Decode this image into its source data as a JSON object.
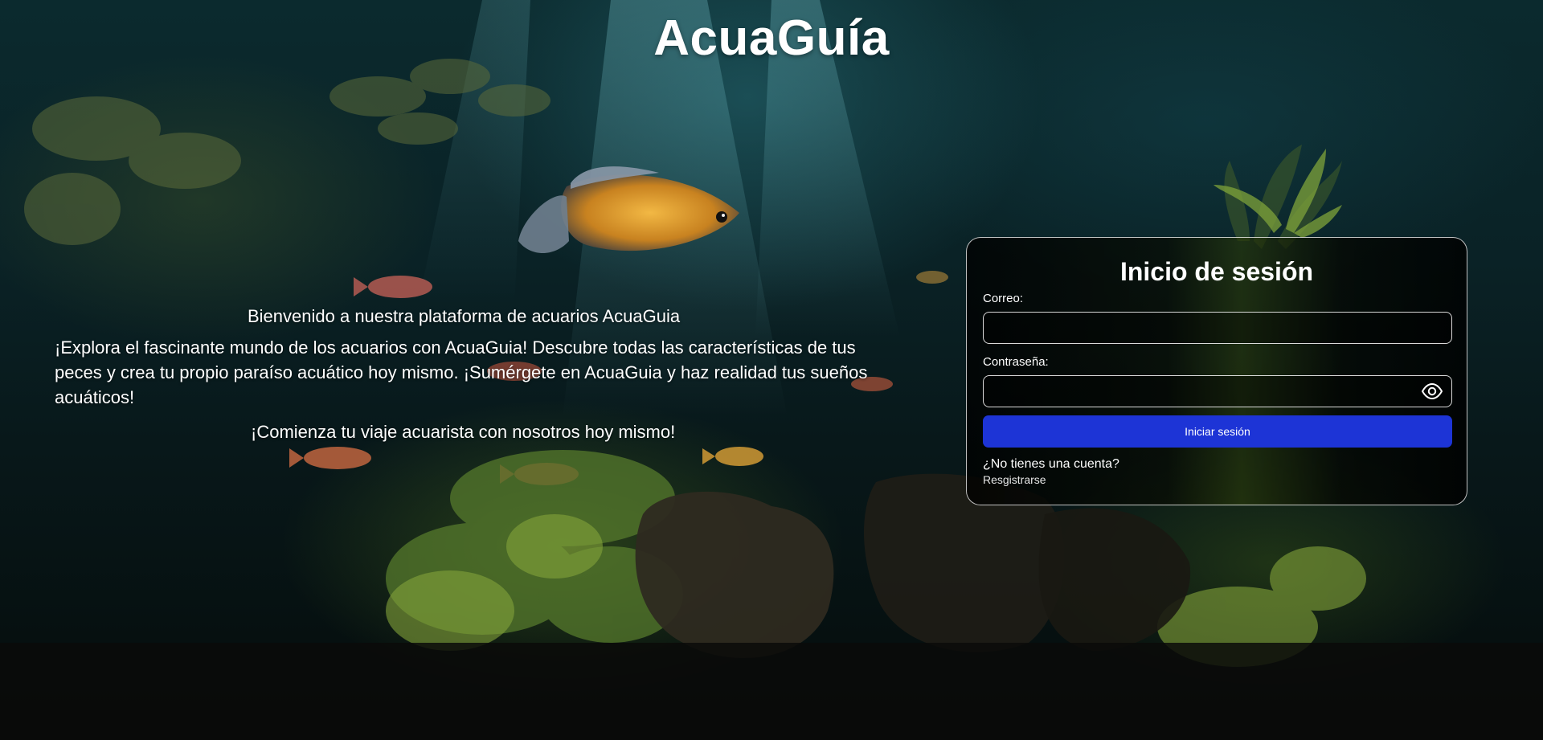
{
  "header": {
    "site_title": "AcuaGuía"
  },
  "intro": {
    "welcome": "Bienvenido a nuestra plataforma de acuarios AcuaGuia",
    "body": "¡Explora el fascinante mundo de los acuarios con AcuaGuia! Descubre todas las características de tus peces y crea tu propio paraíso acuático hoy mismo. ¡Sumérgete en AcuaGuia y haz realidad tus sueños acuáticos!",
    "cta": "¡Comienza tu viaje acuarista con nosotros hoy mismo!"
  },
  "login": {
    "title": "Inicio de sesión",
    "email_label": "Correo:",
    "email_value": "",
    "password_label": "Contraseña:",
    "password_value": "",
    "submit_label": "Iniciar sesión",
    "no_account_text": "¿No tienes una cuenta?",
    "register_label": "Resgistrarse"
  },
  "icons": {
    "password_toggle": "eye-icon"
  },
  "colors": {
    "primary_button": "#1d34d6",
    "text": "#ffffff"
  }
}
